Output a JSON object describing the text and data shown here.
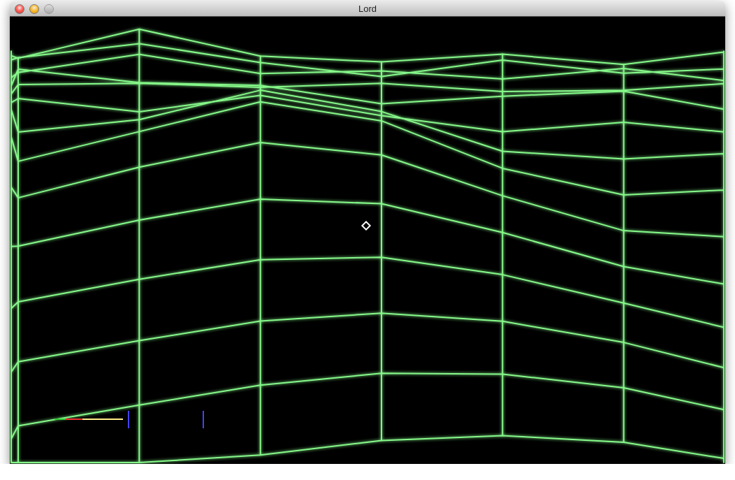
{
  "window": {
    "title": "Lord",
    "controls": [
      {
        "kind": "close",
        "disabled": false
      },
      {
        "kind": "minimize",
        "disabled": false
      },
      {
        "kind": "zoom",
        "disabled": true
      }
    ]
  }
}
